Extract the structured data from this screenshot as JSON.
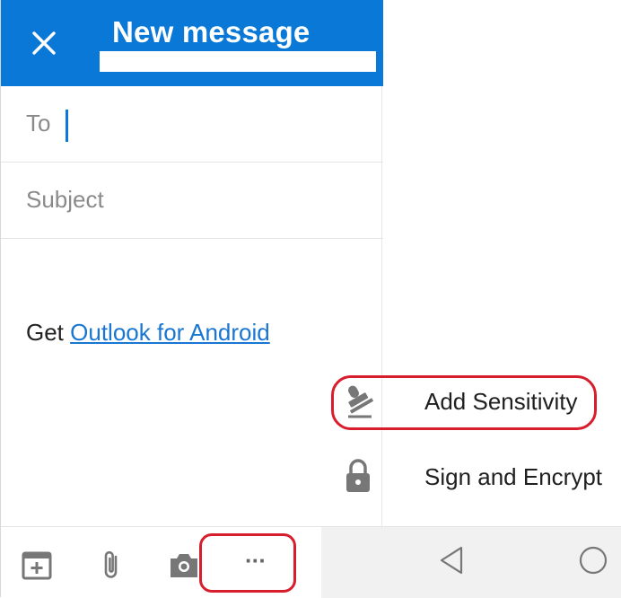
{
  "appbar": {
    "title": "New message",
    "accent_color": "#0a78d7",
    "close_icon": "close-icon"
  },
  "compose": {
    "to_label": "To",
    "to_value": "",
    "subject_placeholder": "Subject",
    "body_prefix": "Get ",
    "body_link_text": "Outlook for Android"
  },
  "toolbar": {
    "icons": [
      "calendar-add-icon",
      "attachment-icon",
      "camera-icon",
      "more-icon"
    ],
    "more_label": "···"
  },
  "menu": {
    "items": [
      {
        "label": "Add Sensitivity",
        "icon": "stamp-icon"
      },
      {
        "label": "Sign and Encrypt",
        "icon": "lock-icon"
      }
    ]
  },
  "navbar": {
    "icons": [
      "back-icon",
      "home-icon"
    ]
  },
  "annotation_color": "#d81e2c"
}
